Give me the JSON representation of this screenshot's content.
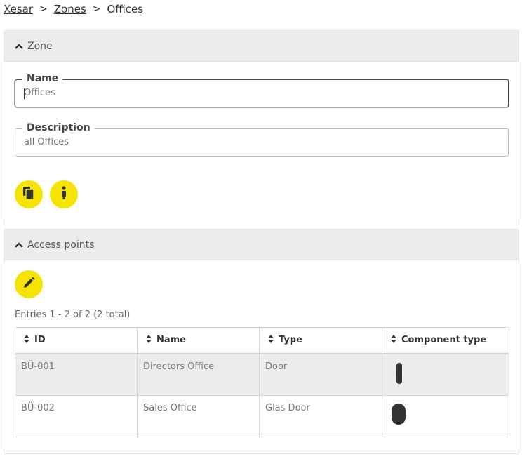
{
  "breadcrumb": {
    "items": [
      "Xesar",
      "Zones"
    ],
    "current": "Offices"
  },
  "zone_panel": {
    "header": "Zone",
    "name_field": {
      "label": "Name",
      "value": "Offices"
    },
    "description_field": {
      "label": "Description",
      "value": "all Offices"
    },
    "buttons": {
      "copy_icon": "copy-icon",
      "info_icon": "info-icon"
    }
  },
  "access_panel": {
    "header": "Access points",
    "edit_icon": "pencil-icon",
    "entries_text": "Entries 1 - 2 of 2 (2 total)",
    "columns": [
      "ID",
      "Name",
      "Type",
      "Component type"
    ],
    "rows": [
      {
        "id": "BÜ-001",
        "name": "Directors Office",
        "type": "Door",
        "component_icon": "wall-reader-icon"
      },
      {
        "id": "BÜ-002",
        "name": "Sales Office",
        "type": "Glas Door",
        "component_icon": "cylinder-icon"
      }
    ]
  },
  "colors": {
    "accent": "#f5e400",
    "header_bg": "#ececec",
    "icon_dark": "#333333"
  }
}
